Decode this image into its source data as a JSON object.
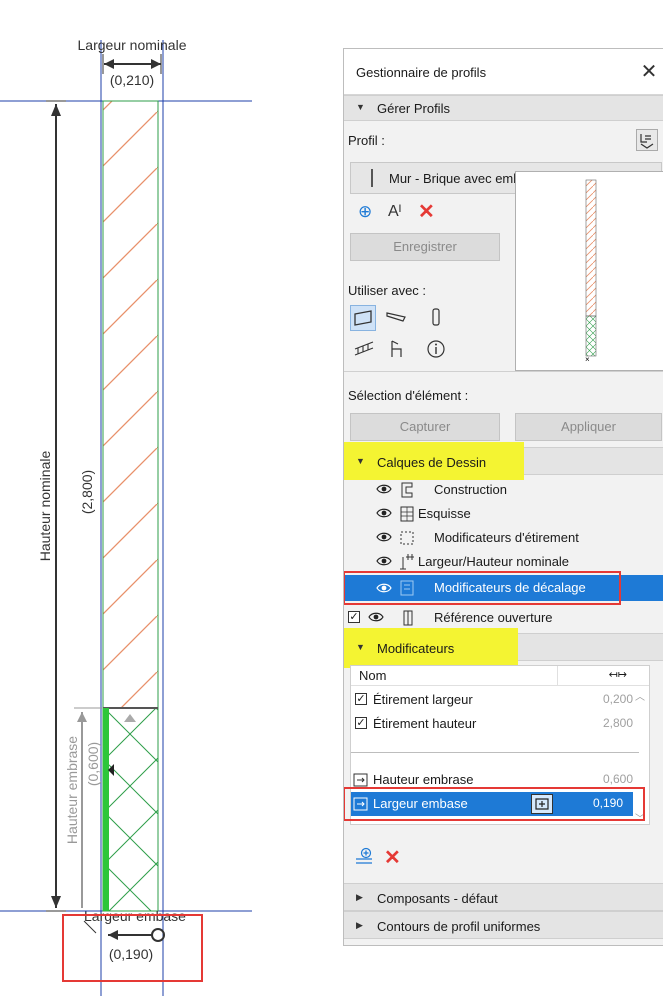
{
  "drawing": {
    "nominal_width_label": "Largeur nominale",
    "nominal_width_value": "(0,210)",
    "nominal_height_label": "Hauteur nominale",
    "nominal_height_value": "(2,800)",
    "base_height_label": "Hauteur embrase",
    "base_height_value": "(0,600)",
    "base_width_label": "Largeur embase",
    "base_width_value": "(0,190)",
    "colors": {
      "hatch": "#e8906a",
      "base_hatch": "#2e9e4a",
      "guide": "#1c3faa",
      "green_line": "#2ec63a",
      "highlight_box": "#e53935"
    }
  },
  "panel": {
    "title": "Gestionnaire de profils",
    "close_icon": "close-icon",
    "manage_section": "Gérer Profils",
    "profile_label": "Profil :",
    "profile_value": "Mur - Brique avec embase béton",
    "save_button": "Enregistrer",
    "use_with_label": "Utiliser avec :",
    "selection_label": "Sélection d'élément :",
    "capture_button": "Capturer",
    "apply_button": "Appliquer",
    "layers_section": "Calques de Dessin",
    "layers": [
      {
        "label": "Construction",
        "icon": "construction-icon"
      },
      {
        "label": "Esquisse",
        "icon": "sketch-icon"
      },
      {
        "label": "Modificateurs d'étirement",
        "icon": "stretch-icon"
      },
      {
        "label": "Largeur/Hauteur nominale",
        "icon": "nominal-size-icon"
      },
      {
        "label": "Modificateurs de décalage",
        "icon": "offset-icon",
        "selected": true
      },
      {
        "label": "Référence ouverture",
        "icon": "opening-icon",
        "checked": true
      }
    ],
    "modifiers_section": "Modificateurs",
    "table_header_name": "Nom",
    "modifiers": [
      {
        "name": "Étirement largeur",
        "value": "0,200",
        "checked": true
      },
      {
        "name": "Étirement hauteur",
        "value": "2,800",
        "checked": true
      },
      {
        "name": "Hauteur embrase",
        "value": "0,600"
      },
      {
        "name": "Largeur embase",
        "value": "0,190",
        "selected": true
      }
    ],
    "components_section": "Composants - défaut",
    "contours_section": "Contours de profil uniformes",
    "accent_color": "#1e7ad6",
    "yellow_highlight": "#f4f432"
  }
}
